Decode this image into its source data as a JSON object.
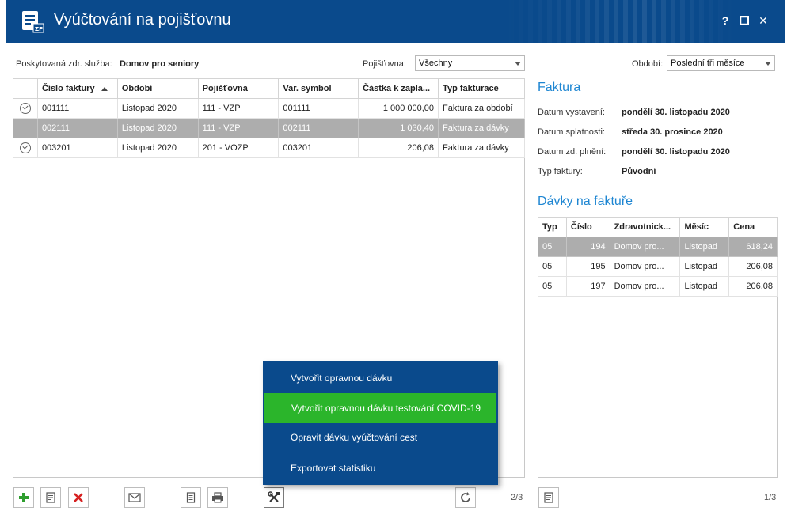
{
  "window": {
    "title": "Vyúčtování na pojišťovnu",
    "help_label": "?",
    "close_label": "✕"
  },
  "filters": {
    "service_label": "Poskytovaná zdr. služba:",
    "service_value": "Domov pro seniory",
    "insurer_label": "Pojišťovna:",
    "insurer_value": "Všechny",
    "period_label": "Období:",
    "period_value": "Poslední tři měsíce"
  },
  "invoices": {
    "columns": [
      "Číslo faktury",
      "Období",
      "Pojišťovna",
      "Var. symbol",
      "Částka k zapla...",
      "Typ fakturace"
    ],
    "rows": [
      {
        "checked": true,
        "number": "001111",
        "period": "Listopad 2020",
        "insurer": "111 - VZP",
        "var_symbol": "001111",
        "amount": "1 000 000,00",
        "type": "Faktura za období",
        "selected": false
      },
      {
        "checked": false,
        "number": "002111",
        "period": "Listopad 2020",
        "insurer": "111 - VZP",
        "var_symbol": "002111",
        "amount": "1 030,40",
        "type": "Faktura za dávky",
        "selected": true
      },
      {
        "checked": true,
        "number": "003201",
        "period": "Listopad 2020",
        "insurer": "201 - VOZP",
        "var_symbol": "003201",
        "amount": "206,08",
        "type": "Faktura za dávky",
        "selected": false
      }
    ],
    "pager": "2/3"
  },
  "invoice_detail": {
    "heading": "Faktura",
    "issued_label": "Datum vystavení:",
    "issued_value": "pondělí 30. listopadu 2020",
    "due_label": "Datum splatnosti:",
    "due_value": "středa 30. prosince 2020",
    "supply_label": "Datum zd. plnění:",
    "supply_value": "pondělí 30. listopadu 2020",
    "type_label": "Typ faktury:",
    "type_value": "Původní"
  },
  "batches": {
    "heading": "Dávky na faktuře",
    "columns": [
      "Typ",
      "Číslo",
      "Zdravotnick...",
      "Měsíc",
      "Cena"
    ],
    "rows": [
      {
        "type": "05",
        "number": "194",
        "facility": "Domov pro...",
        "month": "Listopad",
        "price": "618,24",
        "selected": true
      },
      {
        "type": "05",
        "number": "195",
        "facility": "Domov pro...",
        "month": "Listopad",
        "price": "206,08",
        "selected": false
      },
      {
        "type": "05",
        "number": "197",
        "facility": "Domov pro...",
        "month": "Listopad",
        "price": "206,08",
        "selected": false
      }
    ],
    "pager": "1/3"
  },
  "context_menu": {
    "items": [
      {
        "label": "Vytvořit opravnou dávku",
        "highlighted": false
      },
      {
        "label": "Vytvořit opravnou dávku testování COVID-19",
        "highlighted": true
      },
      {
        "label": "Opravit dávku vyúčtování cest",
        "highlighted": false
      },
      {
        "label": "Exportovat statistiku",
        "highlighted": false
      }
    ]
  },
  "colors": {
    "titlebar": "#0a4a8c",
    "accent": "#1e86d2",
    "menu_highlight": "#2bb52b",
    "add": "#2e9e2e",
    "delete": "#d62020"
  }
}
